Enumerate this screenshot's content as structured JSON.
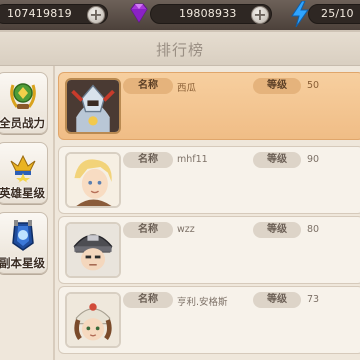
{
  "resources": {
    "gold": "107419819",
    "gems": "19808933",
    "energy": "25/10"
  },
  "panel": {
    "title": "排行榜"
  },
  "tabs": [
    {
      "label": "全员战力",
      "icon": "laurel-trophy-icon"
    },
    {
      "label": "英雄星级",
      "icon": "crown-star-icon"
    },
    {
      "label": "副本星级",
      "icon": "blue-shield-icon"
    }
  ],
  "labels": {
    "name": "名称",
    "level": "等级"
  },
  "rows": [
    {
      "name": "西瓜",
      "level": "50",
      "avatar": "armored-knight-portrait"
    },
    {
      "name": "mhf11",
      "level": "90",
      "avatar": "blonde-hero-portrait"
    },
    {
      "name": "wzz",
      "level": "80",
      "avatar": "helmet-soldier-portrait"
    },
    {
      "name": "亨利.安格斯",
      "level": "73",
      "avatar": "bandana-girl-portrait"
    }
  ],
  "colors": {
    "active_row": "#f3c48f",
    "panel_bg": "#efe7db",
    "topbar": "#5a4e46"
  }
}
